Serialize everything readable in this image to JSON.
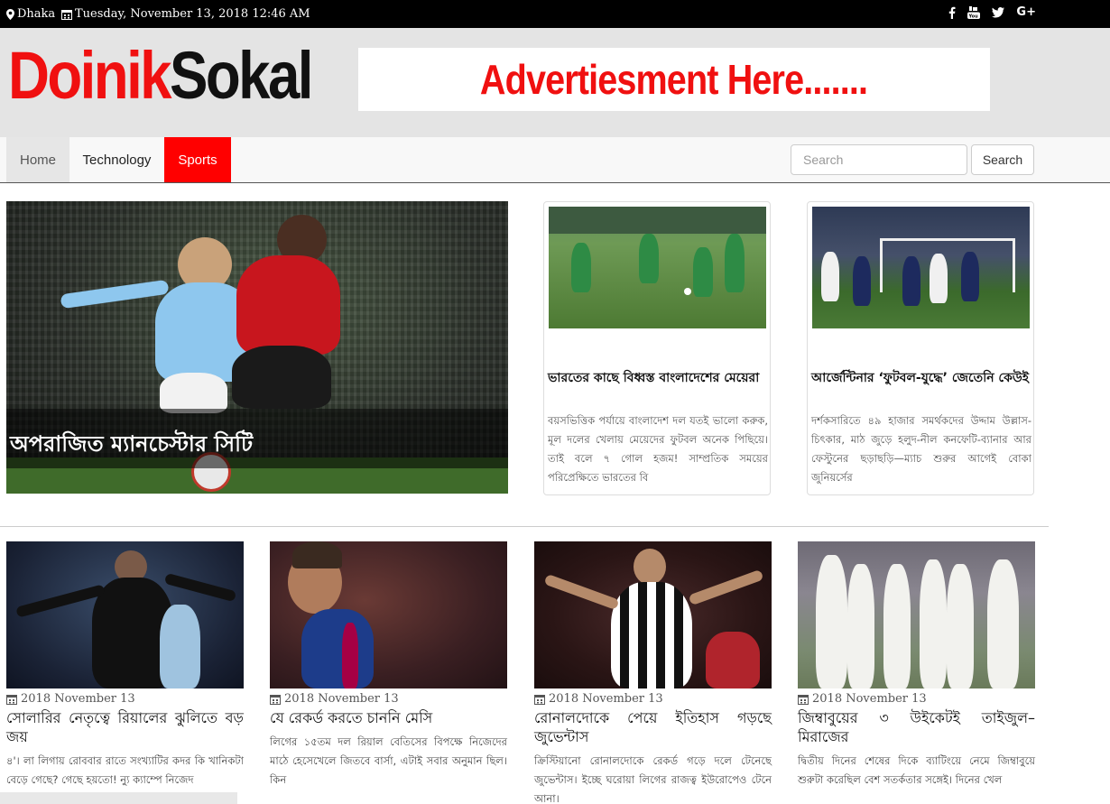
{
  "topbar": {
    "location": "Dhaka",
    "datetime": "Tuesday, November 13, 2018 12:46 AM",
    "social": [
      "f",
      "yt",
      "t",
      "G+"
    ]
  },
  "header": {
    "logo_part1": "Doinik",
    "logo_part2": "Sokal",
    "ad_text": "Advertiesment Here......."
  },
  "nav": {
    "items": [
      {
        "label": "Home"
      },
      {
        "label": "Technology"
      },
      {
        "label": "Sports"
      }
    ],
    "search_placeholder": "Search",
    "search_button": "Search"
  },
  "featured": {
    "caption": "অপরাজিত ম্যানচেস্টার সিটি"
  },
  "side_cards": [
    {
      "title": "ভারতের কাছে বিধ্বস্ত বাংলাদেশের মেয়েরা",
      "excerpt": "বয়সভিত্তিক পর্যায়ে বাংলাদেশ দল যতই ভালো করুক, মূল দলের খেলায় মেয়েদের ফুটবল অনেক পিছিয়ে। তাই বলে ৭ গোল হজম! সাম্প্রতিক সময়ের পরিপ্রেক্ষিতে ভারতের বি"
    },
    {
      "title": "আর্জেন্টিনার ‘ফুটবল-যুদ্ধে’ জেতেনি কেউই",
      "excerpt": "দর্শকসারিতে ৪৯ হাজার সমর্থকদের উদ্দাম উল্লাস-চিৎকার, মাঠ জুড়ে হলুদ-নীল কনফেটি-ব্যানার আর ফেস্টুনের ছড়াছড়ি—ম্যাচ শুরুর আগেই বোকা জুনিয়র্সের"
    }
  ],
  "posts": [
    {
      "date": "2018 November 13",
      "title": "সোলারির নেতৃত্বে রিয়ালের ঝুলিতে বড় জয়",
      "excerpt": "৪'। লা লিগায় রোববার রাতে সংখ্যাটির কদর কি খানিকটা বেড়ে গেছে? গেছে হয়তো! ন্যু ক্যাম্পে নিজেদ"
    },
    {
      "date": "2018 November 13",
      "title": "যে রেকর্ড করতে চাননি মেসি",
      "excerpt": "লিগের ১৫তম দল রিয়াল বেতিসের বিপক্ষে নিজেদের মাঠে হেসেখেলে জিতবে বার্সা, এটাই সবার অনুমান ছিল। কিন"
    },
    {
      "date": "2018 November 13",
      "title": "রোনালদোকে পেয়ে ইতিহাস গড়ছে জুভেন্টাস",
      "excerpt": "ক্রিস্টিয়ানো রোনালদোকে রেকর্ড গড়ে দলে টেনেছে জুভেন্টাস। ইচ্ছে ঘরোয়া লিগের রাজত্ব ইউরোপেও টেনে আনা।"
    },
    {
      "date": "2018 November 13",
      "title": "জিম্বাবুয়ের ৩ উইকেটই তাইজুল–মিরাজের",
      "excerpt": "দ্বিতীয় দিনের শেষের দিকে ব্যাটিংয়ে নেমে জিম্বাবুয়ে শুরুটা করেছিল বেশ সতর্কতার সঙ্গেই। দিনের খেল"
    }
  ],
  "colors": {
    "accent_red": "#ff0000",
    "header_bg": "#e4e4e4",
    "topbar_bg": "#000000"
  }
}
